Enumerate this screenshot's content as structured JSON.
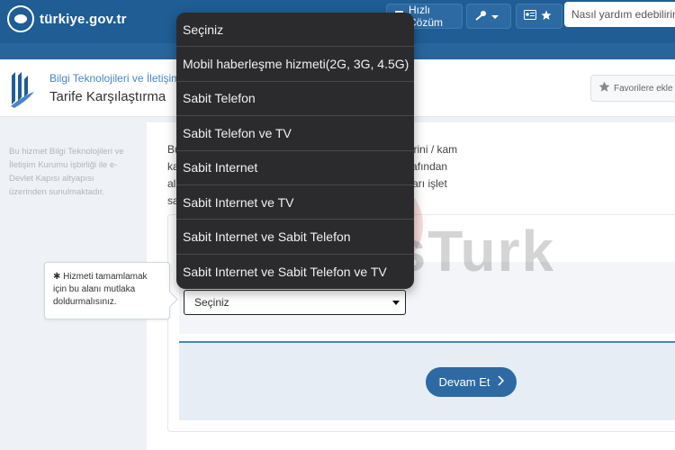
{
  "header": {
    "logo_text": "türkiye.gov.tr",
    "quick_solution": "Hızlı Çözüm",
    "search_placeholder": "Nasıl yardım edebilirim"
  },
  "title_card": {
    "institution": "Bilgi Teknolojileri ve İletişim K",
    "page_title": "Tarife Karşılaştırma",
    "favorite_label": "Favorilere ekle"
  },
  "sidebar": {
    "text": "Bu hizmet Bilgi Teknolojileri ve İletişim Kurumu işbirliği ile e-Devlet Kapısı altyapısı üzerinden sunulmaktadır."
  },
  "intro": {
    "lines": [
      "Bu                                               cilerinin bireysel abone alımına açık olan tarifelerini / kam",
      "ka                                               eknolojileri ve İletişim Kurumu'na işletmeciler tarafından",
      "al                                                urumlu olup tarifelere/kampanyalara ilişkin detayları işlet",
      "sa"
    ]
  },
  "form": {
    "tooltip": "Hizmeti tamamlamak için bu alanı mutlaka doldurmalısınız.",
    "tooltip_star": "✱",
    "select_value": "Seçiniz",
    "next_label": "Devam Et",
    "next_icon": "chevron-right-icon"
  },
  "dropdown": {
    "options": [
      "Seçiniz",
      "Mobil haberleşme hizmeti(2G, 3G, 4.5G)",
      "Sabit Telefon",
      "Sabit Telefon ve TV",
      "Sabit Internet",
      "Sabit Internet ve TV",
      "Sabit Internet ve Sabit Telefon",
      "Sabit Internet ve Sabit Telefon ve TV"
    ]
  },
  "watermark": {
    "text": "NewsTurk"
  },
  "colors": {
    "header_blue": "#1f5d94",
    "accent_blue": "#2d6aa3",
    "dropdown_bg": "#2b2b2d"
  }
}
